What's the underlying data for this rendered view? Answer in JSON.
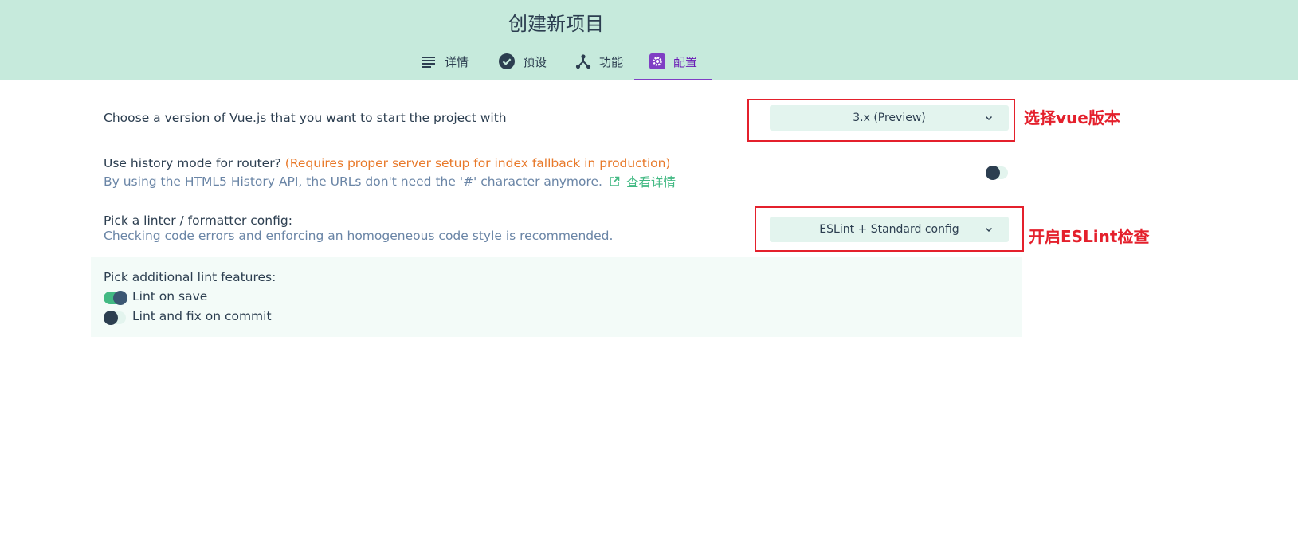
{
  "header": {
    "title": "创建新项目",
    "tabs": [
      {
        "label": "详情",
        "icon": "list-icon"
      },
      {
        "label": "预设",
        "icon": "check-circle-icon"
      },
      {
        "label": "功能",
        "icon": "fork-icon"
      },
      {
        "label": "配置",
        "icon": "settings-icon",
        "active": true
      }
    ]
  },
  "config": {
    "vue_version": {
      "label": "Choose a version of Vue.js that you want to start the project with",
      "selected": "3.x (Preview)"
    },
    "history_mode": {
      "label": "Use history mode for router?",
      "warning": "(Requires proper server setup for index fallback in production)",
      "description": "By using the HTML5 History API, the URLs don't need the '#' character anymore.",
      "link_text": "查看详情",
      "enabled": false
    },
    "linter": {
      "label": "Pick a linter / formatter config:",
      "description": "Checking code errors and enforcing an homogeneous code style is recommended.",
      "selected": "ESLint + Standard config"
    },
    "lint_features": {
      "label": "Pick additional lint features:",
      "options": [
        {
          "label": "Lint on save",
          "enabled": true
        },
        {
          "label": "Lint and fix on commit",
          "enabled": false
        }
      ]
    }
  },
  "annotations": {
    "vue_version_note": "选择vue版本",
    "eslint_note": "开启ESLint检查"
  },
  "colors": {
    "header_bg": "#c6eadc",
    "accent_purple": "#7f3fc4",
    "accent_green": "#42b983",
    "warning_orange": "#e8792a",
    "annotation_red": "#e4202c"
  }
}
